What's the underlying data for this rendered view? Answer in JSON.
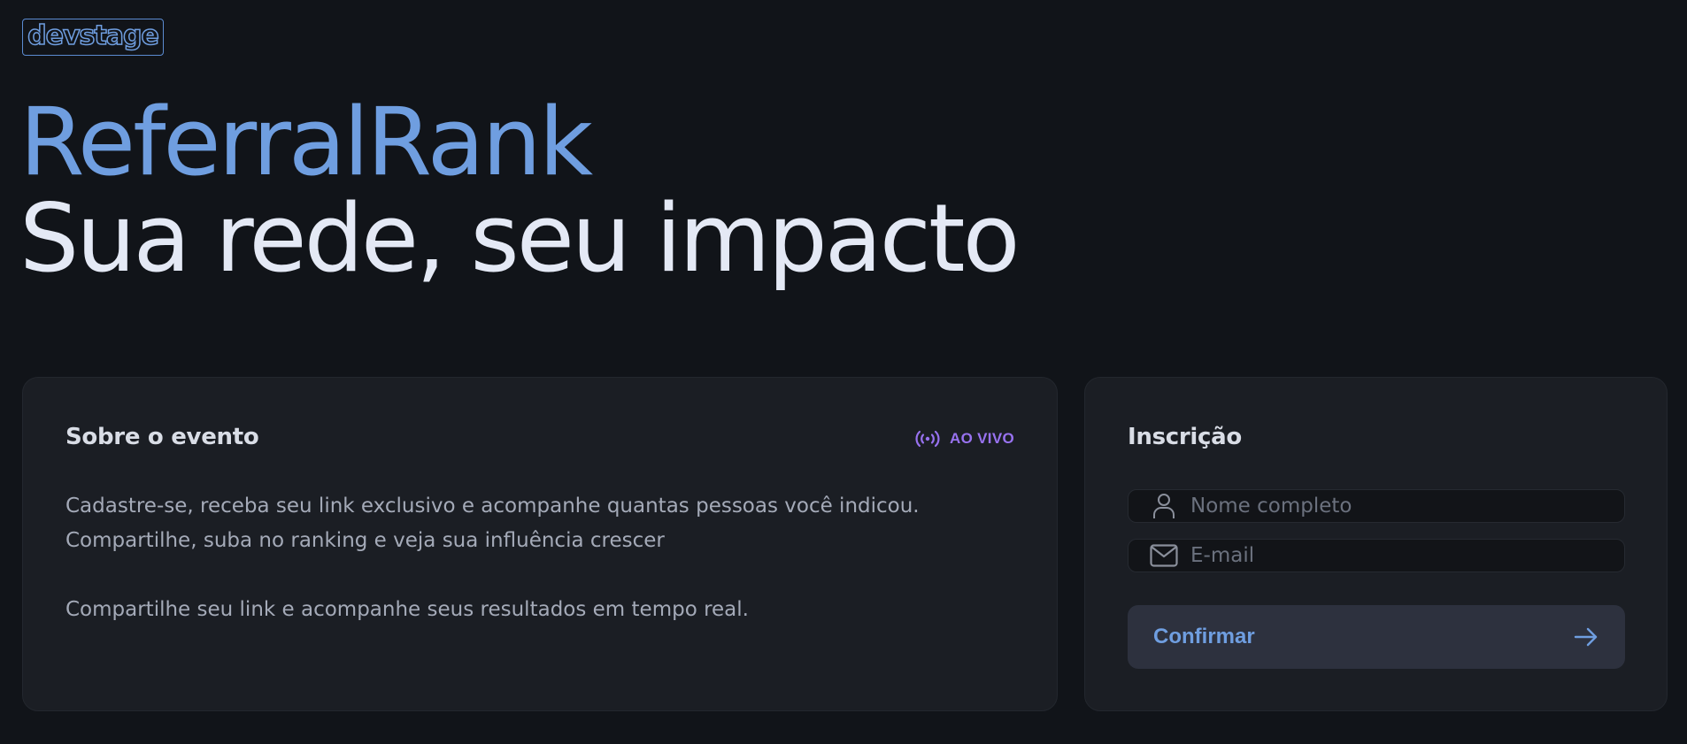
{
  "logo": {
    "text": "devstage"
  },
  "hero": {
    "title": "ReferralRank",
    "subtitle": "Sua rede, seu impacto"
  },
  "about": {
    "title": "Sobre o evento",
    "badge": {
      "label": "AO VIVO",
      "icon": "live-broadcast-icon",
      "color": "#9872f0"
    },
    "paragraphs": [
      "Cadastre-se, receba seu link exclusivo e acompanhe quantas pessoas você indicou. Compartilhe, suba no ranking e veja sua influência crescer",
      "Compartilhe seu link e acompanhe seus resultados em tempo real."
    ]
  },
  "signup": {
    "title": "Inscrição",
    "name_field": {
      "icon": "user-icon",
      "value": "",
      "placeholder": "Nome completo"
    },
    "email_field": {
      "icon": "mail-icon",
      "value": "",
      "placeholder": "E-mail"
    },
    "confirm_button": {
      "label": "Confirmar",
      "icon": "arrow-right-icon"
    }
  },
  "colors": {
    "background": "#111419",
    "card": "#1b1e24",
    "accent": "#6f9ee0",
    "live": "#9872f0",
    "button": "#2d313e"
  }
}
